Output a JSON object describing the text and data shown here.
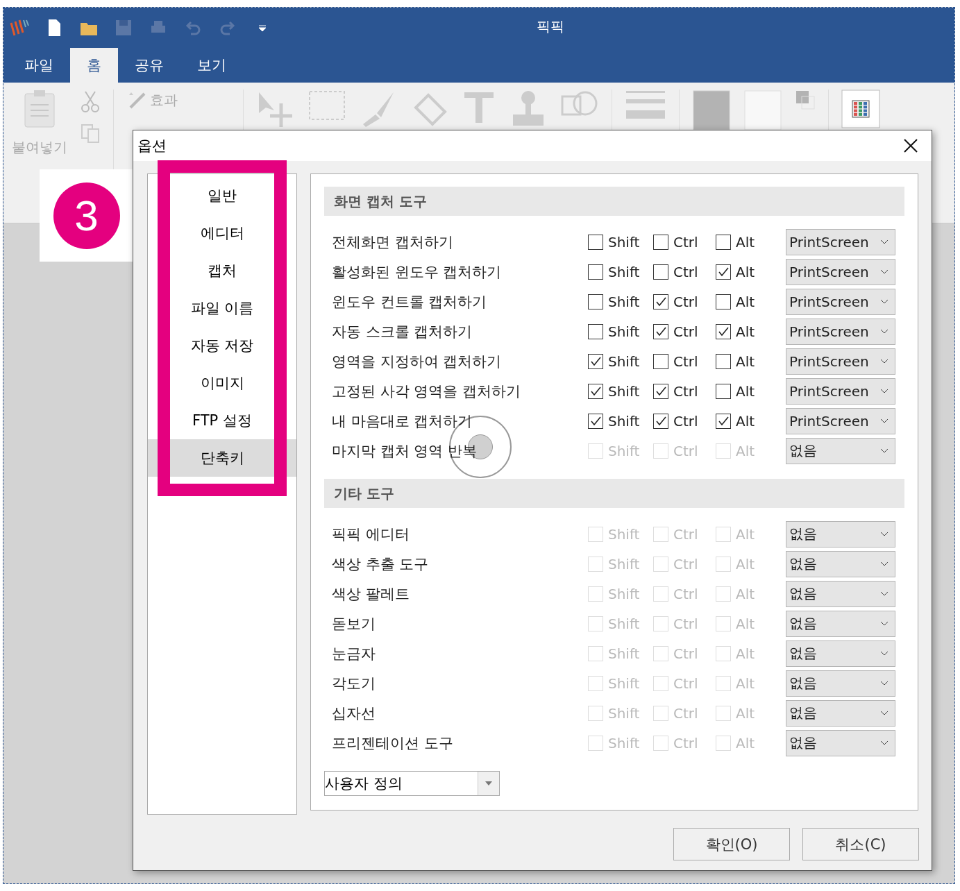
{
  "window": {
    "title": "픽픽"
  },
  "tabs": [
    {
      "label": "파일",
      "selected": false
    },
    {
      "label": "홈",
      "selected": true
    },
    {
      "label": "공유",
      "selected": false
    },
    {
      "label": "보기",
      "selected": false
    }
  ],
  "ribbon": {
    "paste_label": "붙여넣기",
    "effects_label": "효과"
  },
  "step_badge": {
    "number": "3"
  },
  "dialog": {
    "title": "옵션",
    "sidebar": [
      {
        "label": "일반",
        "selected": false
      },
      {
        "label": "에디터",
        "selected": false
      },
      {
        "label": "캡처",
        "selected": false
      },
      {
        "label": "파일 이름",
        "selected": false
      },
      {
        "label": "자동 저장",
        "selected": false
      },
      {
        "label": "이미지",
        "selected": false
      },
      {
        "label": "FTP 설정",
        "selected": false
      },
      {
        "label": "단축키",
        "selected": true
      }
    ],
    "sections": [
      {
        "title": "화면 캡처 도구",
        "rows": [
          {
            "label": "전체화면 캡처하기",
            "disabled": false,
            "modifiers": [
              {
                "label": "Shift",
                "checked": false
              },
              {
                "label": "Ctrl",
                "checked": false
              },
              {
                "label": "Alt",
                "checked": false
              }
            ],
            "key": "PrintScreen"
          },
          {
            "label": "활성화된 윈도우 캡처하기",
            "disabled": false,
            "modifiers": [
              {
                "label": "Shift",
                "checked": false
              },
              {
                "label": "Ctrl",
                "checked": false
              },
              {
                "label": "Alt",
                "checked": true
              }
            ],
            "key": "PrintScreen"
          },
          {
            "label": "윈도우 컨트롤 캡처하기",
            "disabled": false,
            "modifiers": [
              {
                "label": "Shift",
                "checked": false
              },
              {
                "label": "Ctrl",
                "checked": true
              },
              {
                "label": "Alt",
                "checked": false
              }
            ],
            "key": "PrintScreen"
          },
          {
            "label": "자동 스크롤 캡처하기",
            "disabled": false,
            "modifiers": [
              {
                "label": "Shift",
                "checked": false
              },
              {
                "label": "Ctrl",
                "checked": true
              },
              {
                "label": "Alt",
                "checked": true
              }
            ],
            "key": "PrintScreen"
          },
          {
            "label": "영역을 지정하여 캡처하기",
            "disabled": false,
            "modifiers": [
              {
                "label": "Shift",
                "checked": true
              },
              {
                "label": "Ctrl",
                "checked": false
              },
              {
                "label": "Alt",
                "checked": false
              }
            ],
            "key": "PrintScreen"
          },
          {
            "label": "고정된 사각 영역을 캡처하기",
            "disabled": false,
            "modifiers": [
              {
                "label": "Shift",
                "checked": true
              },
              {
                "label": "Ctrl",
                "checked": true
              },
              {
                "label": "Alt",
                "checked": false
              }
            ],
            "key": "PrintScreen"
          },
          {
            "label": "내 마음대로 캡처하기",
            "disabled": false,
            "modifiers": [
              {
                "label": "Shift",
                "checked": true
              },
              {
                "label": "Ctrl",
                "checked": true
              },
              {
                "label": "Alt",
                "checked": true
              }
            ],
            "key": "PrintScreen"
          },
          {
            "label": "마지막 캡처 영역 반복",
            "disabled": true,
            "modifiers": [
              {
                "label": "Shift",
                "checked": false
              },
              {
                "label": "Ctrl",
                "checked": false
              },
              {
                "label": "Alt",
                "checked": false
              }
            ],
            "key": "없음"
          }
        ]
      },
      {
        "title": "기타 도구",
        "rows": [
          {
            "label": "픽픽 에디터",
            "disabled": true,
            "modifiers": [
              {
                "label": "Shift",
                "checked": false
              },
              {
                "label": "Ctrl",
                "checked": false
              },
              {
                "label": "Alt",
                "checked": false
              }
            ],
            "key": "없음"
          },
          {
            "label": "색상 추출 도구",
            "disabled": true,
            "modifiers": [
              {
                "label": "Shift",
                "checked": false
              },
              {
                "label": "Ctrl",
                "checked": false
              },
              {
                "label": "Alt",
                "checked": false
              }
            ],
            "key": "없음"
          },
          {
            "label": "색상 팔레트",
            "disabled": true,
            "modifiers": [
              {
                "label": "Shift",
                "checked": false
              },
              {
                "label": "Ctrl",
                "checked": false
              },
              {
                "label": "Alt",
                "checked": false
              }
            ],
            "key": "없음"
          },
          {
            "label": "돋보기",
            "disabled": true,
            "modifiers": [
              {
                "label": "Shift",
                "checked": false
              },
              {
                "label": "Ctrl",
                "checked": false
              },
              {
                "label": "Alt",
                "checked": false
              }
            ],
            "key": "없음"
          },
          {
            "label": "눈금자",
            "disabled": true,
            "modifiers": [
              {
                "label": "Shift",
                "checked": false
              },
              {
                "label": "Ctrl",
                "checked": false
              },
              {
                "label": "Alt",
                "checked": false
              }
            ],
            "key": "없음"
          },
          {
            "label": "각도기",
            "disabled": true,
            "modifiers": [
              {
                "label": "Shift",
                "checked": false
              },
              {
                "label": "Ctrl",
                "checked": false
              },
              {
                "label": "Alt",
                "checked": false
              }
            ],
            "key": "없음"
          },
          {
            "label": "십자선",
            "disabled": true,
            "modifiers": [
              {
                "label": "Shift",
                "checked": false
              },
              {
                "label": "Ctrl",
                "checked": false
              },
              {
                "label": "Alt",
                "checked": false
              }
            ],
            "key": "없음"
          },
          {
            "label": "프리젠테이션 도구",
            "disabled": true,
            "modifiers": [
              {
                "label": "Shift",
                "checked": false
              },
              {
                "label": "Ctrl",
                "checked": false
              },
              {
                "label": "Alt",
                "checked": false
              }
            ],
            "key": "없음"
          }
        ]
      }
    ],
    "preset": "사용자 정의",
    "buttons": [
      "확인(O)",
      "취소(C)"
    ]
  }
}
